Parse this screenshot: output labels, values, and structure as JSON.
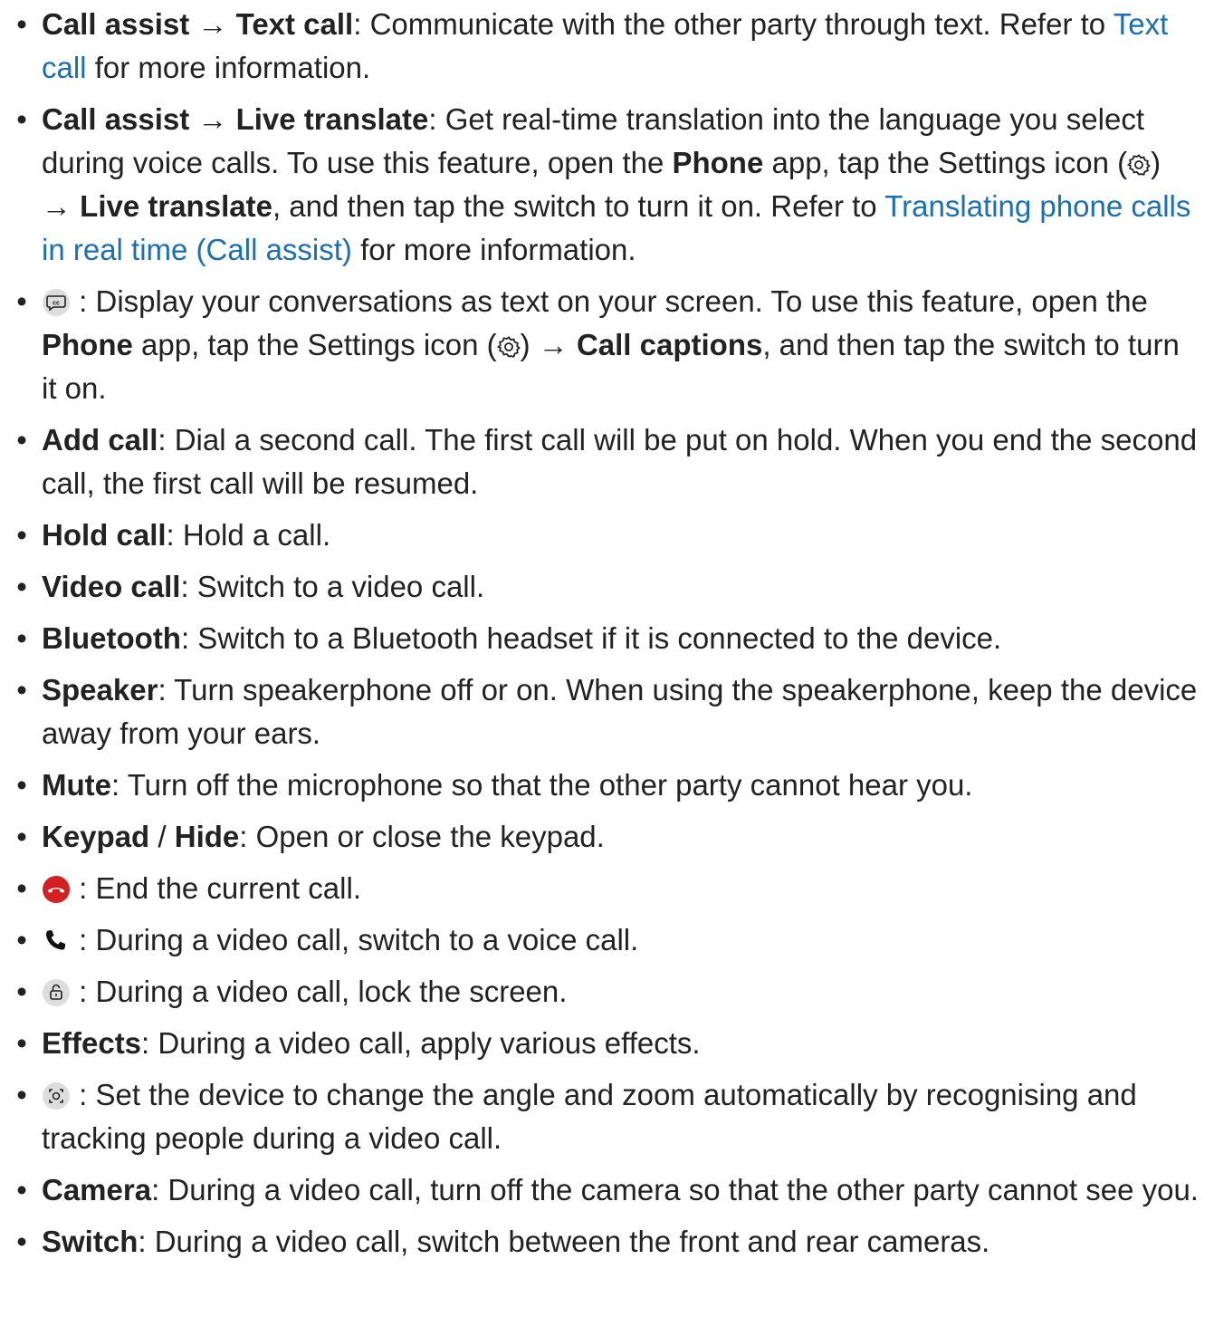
{
  "items": [
    {
      "t1": "Call assist",
      "arrow": "→",
      "t2": "Text call",
      "t3": ": Communicate with the other party through text. Refer to ",
      "link": "Text call",
      "t4": " for more information."
    },
    {
      "t1": "Call assist",
      "arrow": "→",
      "t2": "Live translate",
      "t3": ": Get real-time translation into the language you select during voice calls. To use this feature, open the ",
      "t4": "Phone",
      "t5": " app, tap the Settings icon (",
      "t6": ") ",
      "arrow2": "→",
      "t7": "Live translate",
      "t8": ", and then tap the switch to turn it on. Refer to ",
      "link": "Translating phone calls in real time (Call assist)",
      "t9": " for more information."
    },
    {
      "t1": ": Display your conversations as text on your screen. To use this feature, open the ",
      "t2": "Phone",
      "t3": " app, tap the Settings icon (",
      "t4": ") ",
      "arrow": "→",
      "t5": "Call captions",
      "t6": ", and then tap the switch to turn it on."
    },
    {
      "t1": "Add call",
      "t2": ": Dial a second call. The first call will be put on hold. When you end the second call, the first call will be resumed."
    },
    {
      "t1": "Hold call",
      "t2": ": Hold a call."
    },
    {
      "t1": "Video call",
      "t2": ": Switch to a video call."
    },
    {
      "t1": "Bluetooth",
      "t2": ": Switch to a Bluetooth headset if it is connected to the device."
    },
    {
      "t1": "Speaker",
      "t2": ": Turn speakerphone off or on. When using the speakerphone, keep the device away from your ears."
    },
    {
      "t1": "Mute",
      "t2": ": Turn off the microphone so that the other party cannot hear you."
    },
    {
      "t1": "Keypad",
      "sep": " / ",
      "t2": "Hide",
      "t3": ": Open or close the keypad."
    },
    {
      "t1": ": End the current call."
    },
    {
      "t1": ": During a video call, switch to a voice call."
    },
    {
      "t1": ": During a video call, lock the screen."
    },
    {
      "t1": "Effects",
      "t2": ": During a video call, apply various effects."
    },
    {
      "t1": ": Set the device to change the angle and zoom automatically by recognising and tracking people during a video call."
    },
    {
      "t1": "Camera",
      "t2": ": During a video call, turn off the camera so that the other party cannot see you."
    },
    {
      "t1": "Switch",
      "t2": ": During a video call, switch between the front and rear cameras."
    }
  ],
  "bullet": "•",
  "colors": {
    "link": "#1b6fb3",
    "end_call": "#d32020",
    "icon_gray": "#dddddd",
    "text": "#222222"
  },
  "icons": [
    "captions-icon",
    "settings-gear-icon",
    "end-call-icon",
    "voice-call-icon",
    "lock-screen-icon",
    "auto-framing-icon"
  ]
}
